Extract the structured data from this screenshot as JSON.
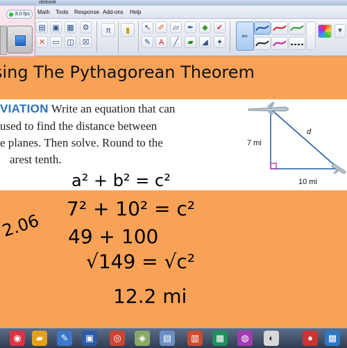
{
  "window": {
    "title": "otebook"
  },
  "menu": [
    "Math",
    "Tools",
    "Response",
    "Add-ons",
    "Help"
  ],
  "recorder": {
    "fps": "8.0 fps"
  },
  "slide": {
    "title": "sing The Pythagorean Theorem",
    "problem": {
      "lead": "VIATION",
      "lines": [
        "Write an equation that can",
        " used to find the distance between",
        "e planes. Then solve. Round to the",
        "arest tenth."
      ]
    },
    "diagram": {
      "height_label": "7 mi",
      "base_label": "10 mi",
      "hyp_label": "d"
    },
    "work": {
      "line1": "a² + b² = c²",
      "line2": "7² + 10² = c²",
      "line3": "49 + 100",
      "line4": "√149 = √c²",
      "line5": "12.2 mi",
      "margin_note": "2.06"
    }
  },
  "colors": {
    "background": "#f7a257",
    "problem_bg": "#ffffff",
    "lead": "#2a6fb8",
    "taskbar": "#3d4b63"
  }
}
